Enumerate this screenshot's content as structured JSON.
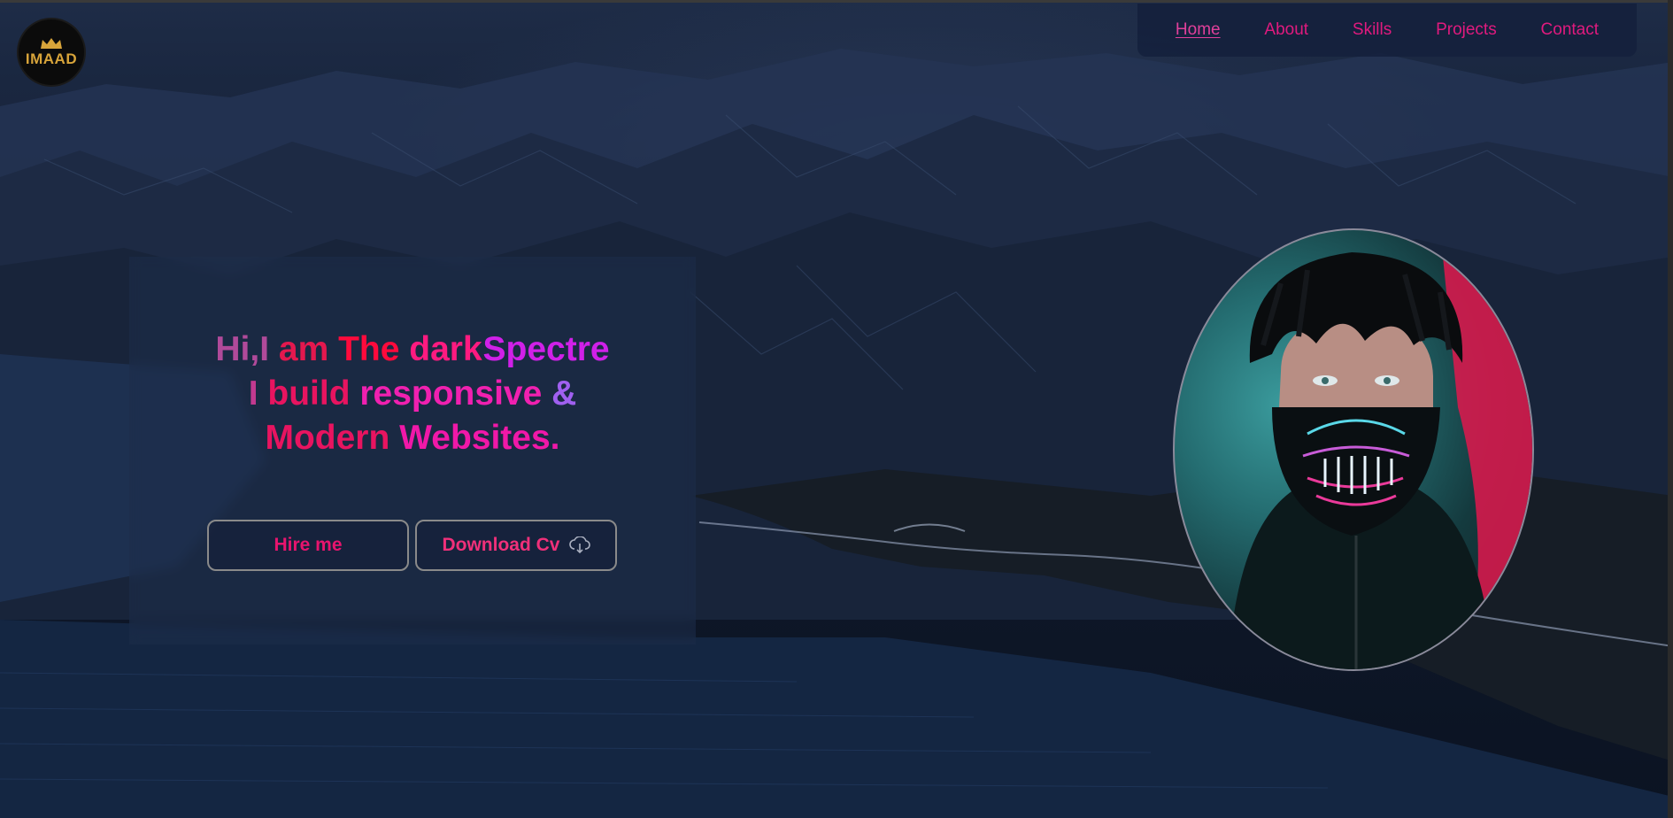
{
  "logo": {
    "text": "IMAAD",
    "icon": "crown-icon"
  },
  "nav": {
    "items": [
      {
        "label": "Home",
        "active": true
      },
      {
        "label": "About",
        "active": false
      },
      {
        "label": "Skills",
        "active": false
      },
      {
        "label": "Projects",
        "active": false
      },
      {
        "label": "Contact",
        "active": false
      }
    ]
  },
  "hero": {
    "line1": {
      "part1": "Hi,I",
      "part2": "am",
      "part3": "The",
      "part4": "dark",
      "part5": "Spectre"
    },
    "line2": {
      "part1": "I",
      "part2": "build",
      "part3": "responsive",
      "part4": "&"
    },
    "line3": {
      "part1": "Modern",
      "part2": "Websites."
    },
    "hire_label": "Hire me",
    "cv_label": "Download Cv",
    "cv_icon": "cloud-download-icon"
  },
  "colors": {
    "accent": "#e8146e",
    "nav_bg": "#14203c",
    "background": "#0c1424"
  }
}
